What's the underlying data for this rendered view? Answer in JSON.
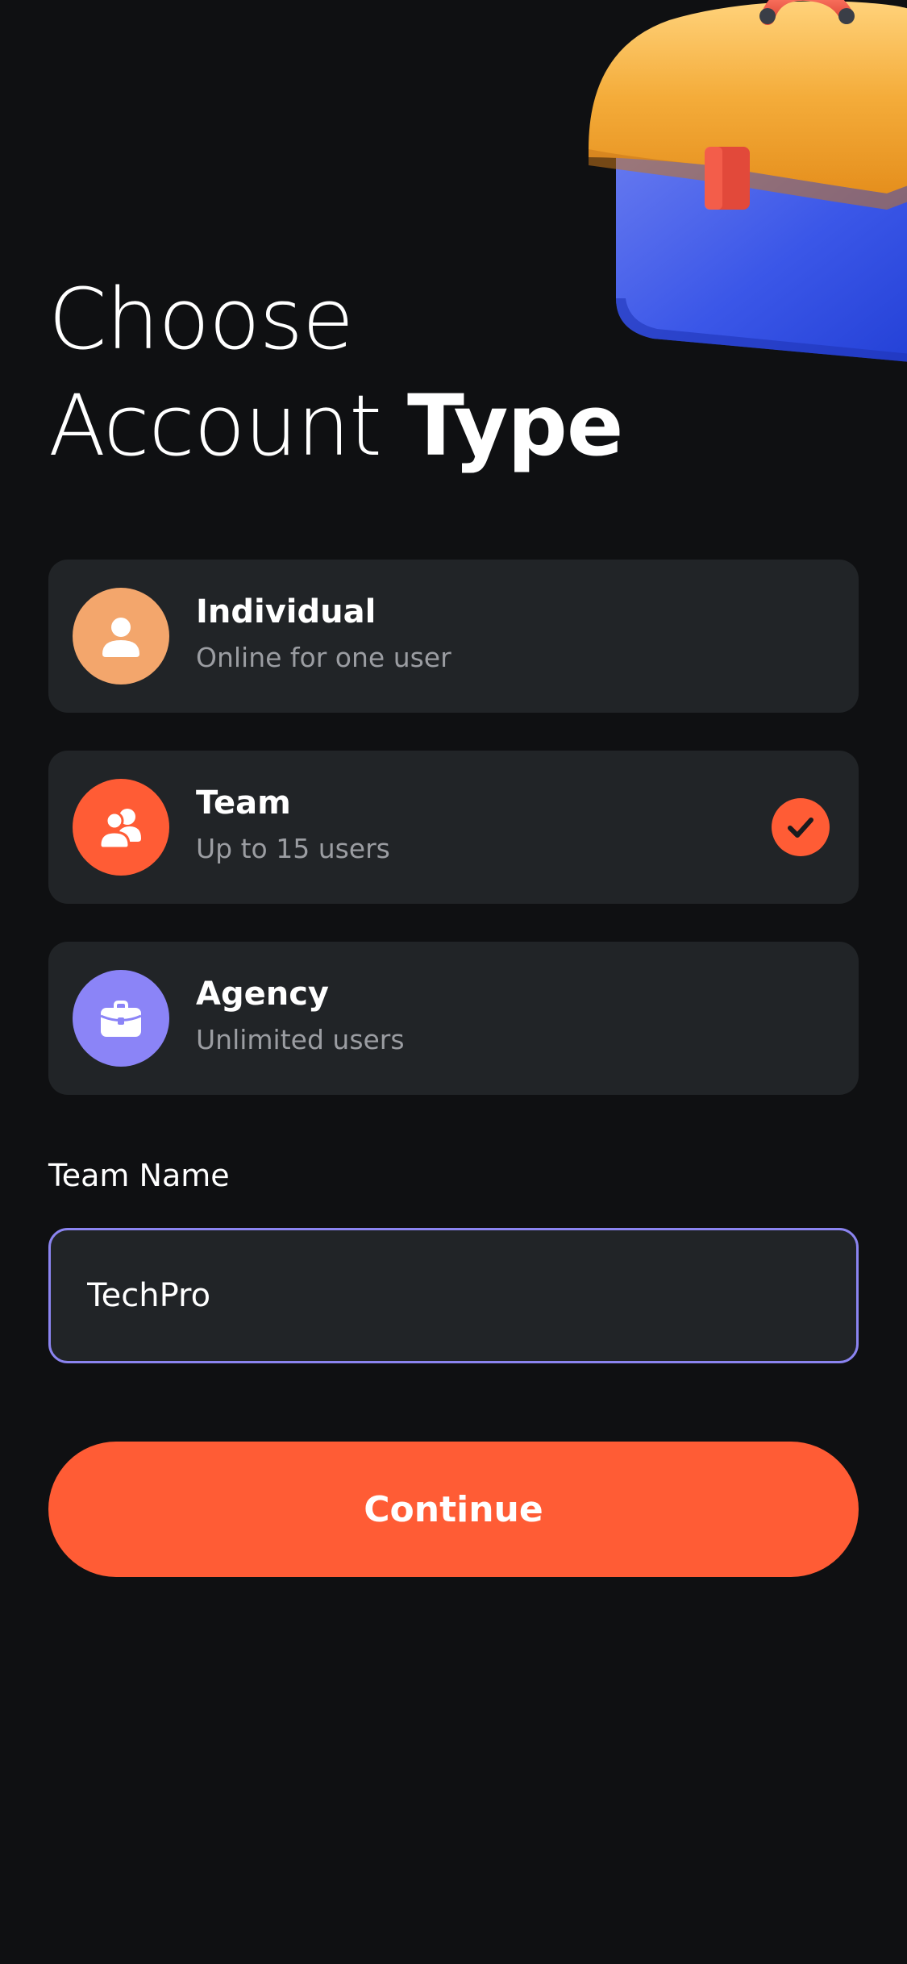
{
  "colors": {
    "background": "#0f1012",
    "card": "#212427",
    "accent": "#ff5c35",
    "individual_icon_bg": "#f3a66c",
    "team_icon_bg": "#ff5c35",
    "agency_icon_bg": "#8b84f7",
    "input_border": "#8b84f0",
    "subtitle_text": "#9b9da2"
  },
  "header": {
    "title_line1": "Choose",
    "title_line2_regular": "Account",
    "title_line2_bold": "Type",
    "illustration": "toolbox-illustration"
  },
  "options": [
    {
      "title": "Individual",
      "subtitle": "Online for one user",
      "icon": "user-icon",
      "selected": false
    },
    {
      "title": "Team",
      "subtitle": "Up to 15 users",
      "icon": "users-icon",
      "selected": true
    },
    {
      "title": "Agency",
      "subtitle": "Unlimited users",
      "icon": "briefcase-icon",
      "selected": false
    }
  ],
  "team_name": {
    "label": "Team Name",
    "value": "TechPro"
  },
  "continue_button": {
    "label": "Continue"
  }
}
